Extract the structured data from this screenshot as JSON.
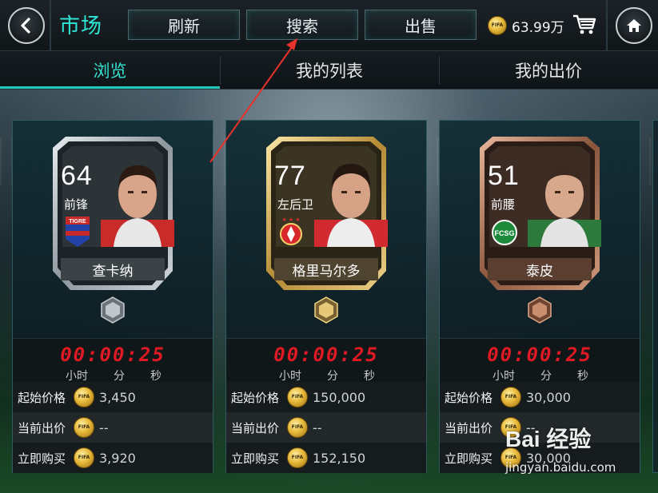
{
  "header": {
    "title": "市场",
    "tabs": [
      {
        "label": "刷新"
      },
      {
        "label": "搜索"
      },
      {
        "label": "出售"
      }
    ],
    "balance": "63.99万"
  },
  "subtabs": [
    {
      "label": "浏览",
      "active": true
    },
    {
      "label": "我的列表",
      "active": false
    },
    {
      "label": "我的出价",
      "active": false
    }
  ],
  "price_labels": {
    "start": "起始价格",
    "current": "当前出价",
    "buy_now": "立即购买"
  },
  "timer_units": {
    "h": "小时",
    "m": "分",
    "s": "秒"
  },
  "cards": [
    {
      "rating": "64",
      "position": "前锋",
      "name": "查卡纳",
      "tier": "silver",
      "club_crest_text": "TIGRE",
      "timer": "00:00:25",
      "start_price": "3,450",
      "current_bid": "--",
      "buy_now": "3,920"
    },
    {
      "rating": "77",
      "position": "左后卫",
      "name": "格里马尔多",
      "tier": "gold",
      "timer": "00:00:25",
      "start_price": "150,000",
      "current_bid": "--",
      "buy_now": "152,150"
    },
    {
      "rating": "51",
      "position": "前腰",
      "name": "泰皮",
      "tier": "bronze",
      "club_crest_text": "FCSG",
      "timer": "00:00:25",
      "start_price": "30,000",
      "current_bid": "--",
      "buy_now": "30,000"
    }
  ],
  "watermark": {
    "main": "Bai 经验",
    "url": "jingyan.baidu.com"
  },
  "colors": {
    "accent": "#2ee6d6",
    "timer": "#e01a24",
    "silver": "#9aa4aa",
    "gold": "#c9a24c",
    "bronze": "#a86a4c"
  }
}
